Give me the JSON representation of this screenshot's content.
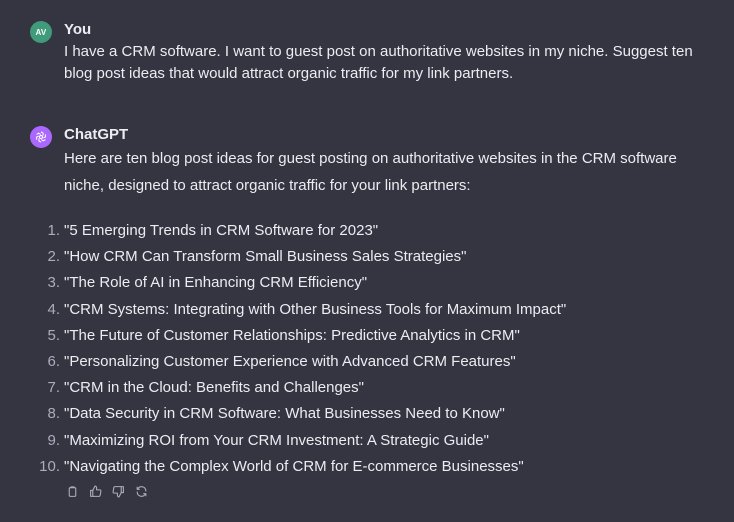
{
  "user_message": {
    "avatar_initials": "AV",
    "author": "You",
    "text": "I have a CRM software. I want to guest post on authoritative websites in my niche. Suggest ten blog post ideas that would attract organic traffic for my link partners."
  },
  "assistant_message": {
    "avatar_icon": "openai-logo-icon",
    "author": "ChatGPT",
    "intro": "Here are ten blog post ideas for guest posting on authoritative websites in the CRM software niche, designed to attract organic traffic for your link partners:",
    "ideas": [
      {
        "num": "1.",
        "text": "\"5 Emerging Trends in CRM Software for 2023\""
      },
      {
        "num": "2.",
        "text": "\"How CRM Can Transform Small Business Sales Strategies\""
      },
      {
        "num": "3.",
        "text": "\"The Role of AI in Enhancing CRM Efficiency\""
      },
      {
        "num": "4.",
        "text": "\"CRM Systems: Integrating with Other Business Tools for Maximum Impact\""
      },
      {
        "num": "5.",
        "text": "\"The Future of Customer Relationships: Predictive Analytics in CRM\""
      },
      {
        "num": "6.",
        "text": "\"Personalizing Customer Experience with Advanced CRM Features\""
      },
      {
        "num": "7.",
        "text": "\"CRM in the Cloud: Benefits and Challenges\""
      },
      {
        "num": "8.",
        "text": "\"Data Security in CRM Software: What Businesses Need to Know\""
      },
      {
        "num": "9.",
        "text": "\"Maximizing ROI from Your CRM Investment: A Strategic Guide\""
      },
      {
        "num": "10.",
        "text": "\"Navigating the Complex World of CRM for E-commerce Businesses\""
      }
    ],
    "actions": [
      "copy-icon",
      "thumbs-up-icon",
      "thumbs-down-icon",
      "regenerate-icon"
    ]
  },
  "colors": {
    "background": "#343541",
    "text": "#ececf1",
    "muted": "#acacbe",
    "user_avatar": "#3f9b79",
    "gpt_avatar": "#ab68ff"
  }
}
